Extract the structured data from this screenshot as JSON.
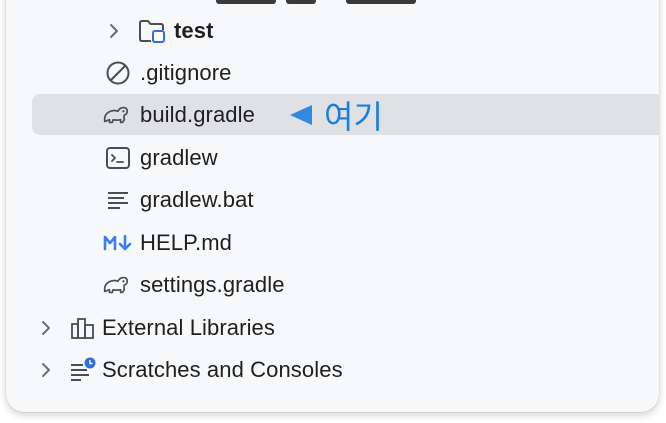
{
  "tree": {
    "items": [
      {
        "label": "test",
        "icon": "test-folder-icon"
      },
      {
        "label": ".gitignore",
        "icon": "ignored-file-icon"
      },
      {
        "label": "build.gradle",
        "icon": "gradle-elephant-icon"
      },
      {
        "label": "gradlew",
        "icon": "terminal-script-icon"
      },
      {
        "label": "gradlew.bat",
        "icon": "text-lines-icon"
      },
      {
        "label": "HELP.md",
        "icon": "markdown-icon"
      },
      {
        "label": "settings.gradle",
        "icon": "gradle-elephant-icon"
      },
      {
        "label": "External Libraries",
        "icon": "libraries-icon"
      },
      {
        "label": "Scratches and Consoles",
        "icon": "scratches-icon"
      }
    ],
    "selected_index": 2
  },
  "annotation": {
    "text": "여기",
    "color": "#1a7fd8"
  },
  "colors": {
    "panel_bg": "#f7f8fa",
    "selected_bg": "#dfe1e5",
    "icon_gray": "#5a5d63",
    "markdown_blue": "#3d7df0",
    "folder_blue": "#2f6fdb"
  }
}
